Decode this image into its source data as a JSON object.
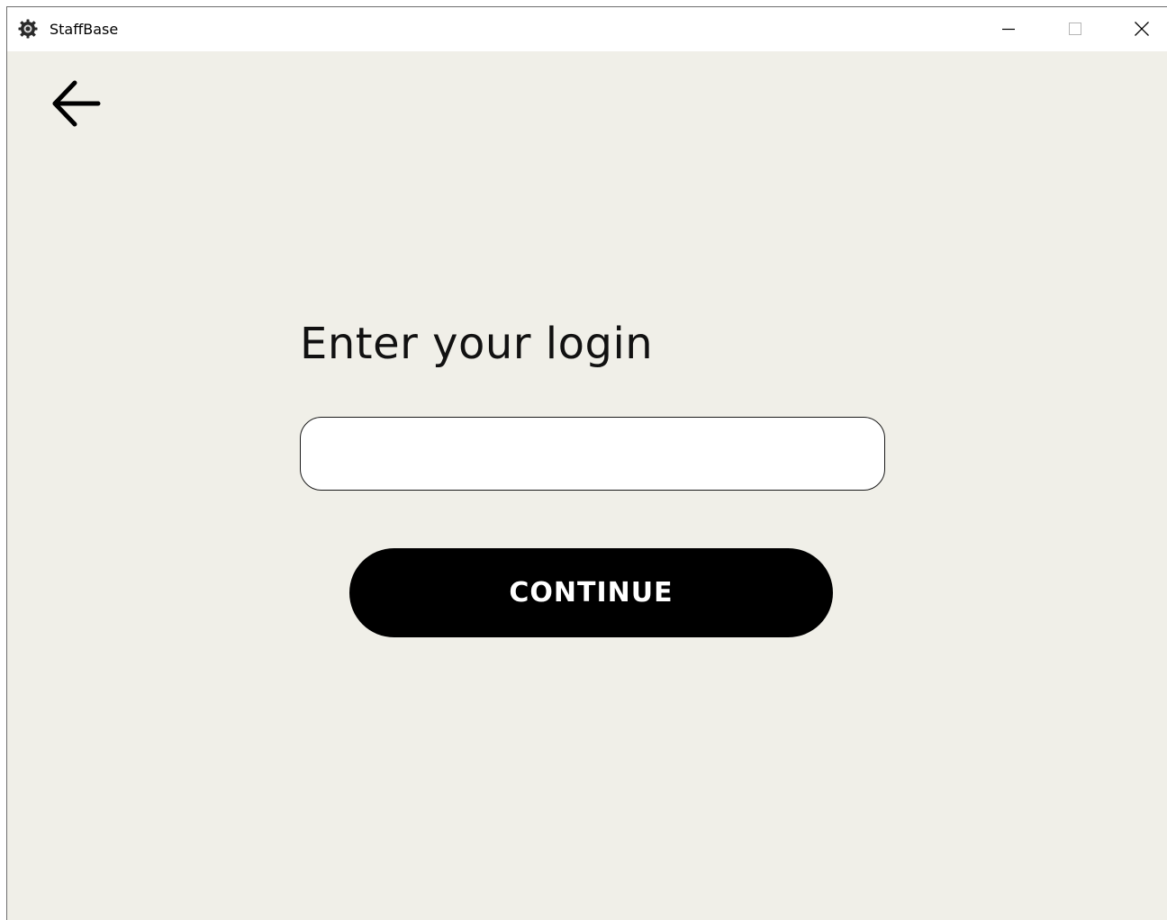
{
  "window": {
    "title": "StaffBase",
    "app_icon": "gear-badge-icon",
    "controls": {
      "minimize_icon": "minimize-icon",
      "maximize_icon": "maximize-icon",
      "close_icon": "close-icon"
    }
  },
  "nav": {
    "back_icon": "arrow-left-icon"
  },
  "login": {
    "title": "Enter your login",
    "input_value": "",
    "input_placeholder": "",
    "continue_label": "CONTINUE"
  },
  "colors": {
    "background": "#f0efe8",
    "button": "#000000",
    "button_text": "#ffffff",
    "input_bg": "#ffffff"
  }
}
